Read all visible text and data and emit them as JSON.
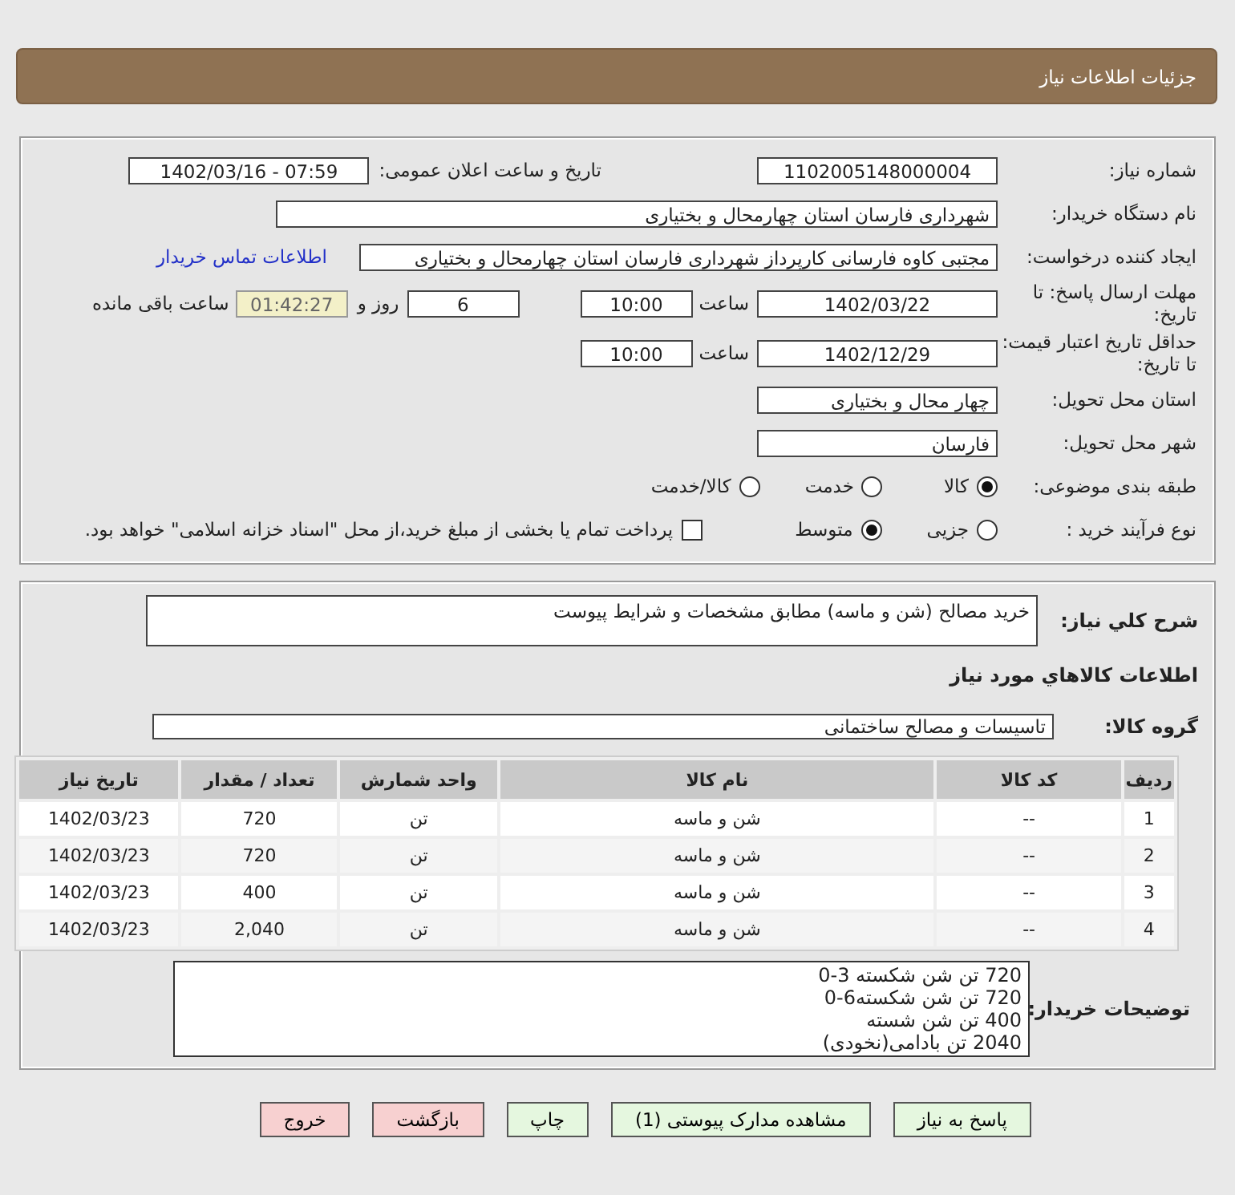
{
  "page_title": "جزئیات اطلاعات نیاز",
  "need_number": {
    "label": "شماره نیاز:",
    "value": "1102005148000004"
  },
  "announce": {
    "label": "تاریخ و ساعت اعلان عمومی:",
    "value": "1402/03/16 - 07:59"
  },
  "buyer_org": {
    "label": "نام دستگاه خریدار:",
    "value": "شهرداری فارسان استان چهارمحال و بختیاری"
  },
  "requester": {
    "label": "ایجاد کننده درخواست:",
    "value": "مجتبی کاوه فارسانی کارپرداز  شهرداری فارسان استان چهارمحال و بختیاری",
    "link": "اطلاعات تماس خریدار"
  },
  "deadline": {
    "label": "مهلت ارسال پاسخ: تا تاریخ:",
    "date": "1402/03/22",
    "time_label": "ساعت",
    "time": "10:00",
    "days": "6",
    "days_label": "روز و",
    "remaining": "01:42:27",
    "remaining_label": "ساعت باقی مانده"
  },
  "validity": {
    "label": "حداقل تاریخ اعتبار قیمت: تا تاریخ:",
    "date": "1402/12/29",
    "time_label": "ساعت",
    "time": "10:00"
  },
  "province": {
    "label": "استان محل تحویل:",
    "value": "چهار محال و بختیاری"
  },
  "city": {
    "label": "شهر محل تحویل:",
    "value": "فارسان"
  },
  "category": {
    "label": "طبقه بندی موضوعی:",
    "options": [
      {
        "label": "کالا",
        "selected": true
      },
      {
        "label": "خدمت",
        "selected": false
      },
      {
        "label": "کالا/خدمت",
        "selected": false
      }
    ]
  },
  "process": {
    "label": "نوع فرآیند خرید :",
    "options": [
      {
        "label": "جزیی",
        "selected": false
      },
      {
        "label": "متوسط",
        "selected": true
      }
    ],
    "payment": {
      "checked": false,
      "text": "پرداخت تمام یا بخشی از مبلغ خرید،از محل \"اسناد خزانه اسلامی\" خواهد بود."
    }
  },
  "description": {
    "label": "شرح کلي نياز:",
    "value": "خرید مصالح (شن و ماسه) مطابق مشخصات و شرایط پیوست"
  },
  "goods_heading": "اطلاعات کالاهاي مورد نياز",
  "goods_group": {
    "label": "گروه کالا:",
    "value": "تاسیسات و مصالح ساختمانی"
  },
  "table": {
    "columns": [
      "ردیف",
      "کد کالا",
      "نام کالا",
      "واحد شمارش",
      "تعداد / مقدار",
      "تاریخ نیاز"
    ],
    "rows": [
      [
        "1",
        "--",
        "شن و ماسه",
        "تن",
        "720",
        "1402/03/23"
      ],
      [
        "2",
        "--",
        "شن و ماسه",
        "تن",
        "720",
        "1402/03/23"
      ],
      [
        "3",
        "--",
        "شن و ماسه",
        "تن",
        "400",
        "1402/03/23"
      ],
      [
        "4",
        "--",
        "شن و ماسه",
        "تن",
        "2,040",
        "1402/03/23"
      ]
    ]
  },
  "buyer_notes": {
    "label": "توضیحات خریدار:",
    "lines": [
      "720 تن شن شکسته 3-0",
      "720 تن شن شکسته6-0",
      "400 تن شن شسته",
      "2040 تن بادامی(نخودی)"
    ]
  },
  "buttons": [
    {
      "label": "پاسخ به نیاز",
      "kind": "normal"
    },
    {
      "label": "مشاهده مدارک پیوستی (1)",
      "kind": "normal"
    },
    {
      "label": "چاپ",
      "kind": "normal"
    },
    {
      "label": "بازگشت",
      "kind": "danger"
    },
    {
      "label": "خروج",
      "kind": "danger"
    }
  ]
}
